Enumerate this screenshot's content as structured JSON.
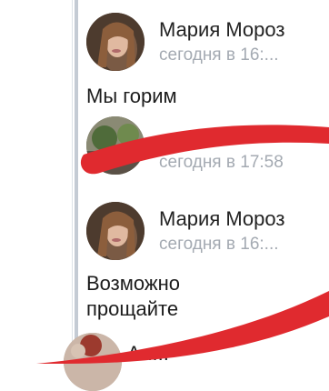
{
  "comments": [
    {
      "author": "Мария Мороз",
      "time": "сегодня в 16:...",
      "text_lines": [
        "Мы горим"
      ]
    },
    {
      "author": "",
      "time": "сегодня в 17:58",
      "text_lines": []
    },
    {
      "author": "Мария Мороз",
      "time": "сегодня в 16:...",
      "text_lines": [
        "Возможно",
        "прощайте"
      ]
    },
    {
      "author": "Ал...",
      "time": "",
      "text_lines": []
    }
  ],
  "redaction_color": "#e02a2f"
}
